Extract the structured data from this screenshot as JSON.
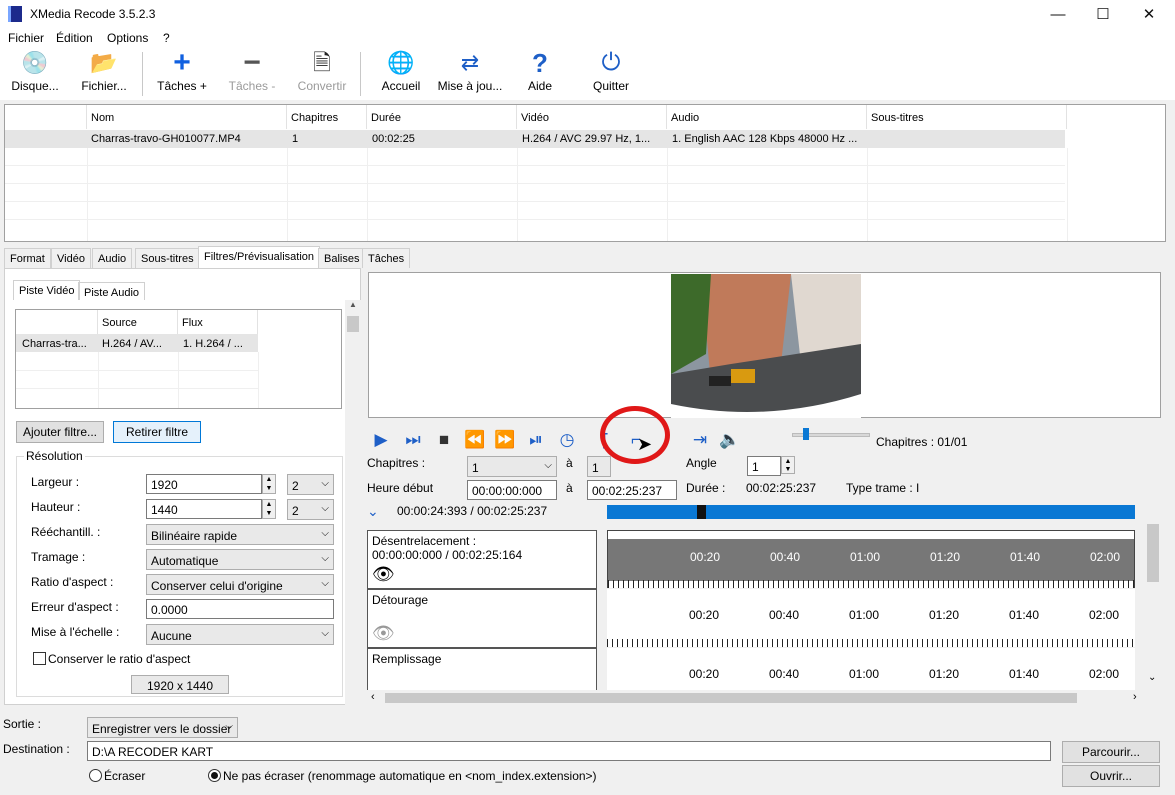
{
  "window": {
    "title": "XMedia Recode 3.5.2.3"
  },
  "menu": [
    "Fichier",
    "Édition",
    "Options",
    "?"
  ],
  "toolbar": {
    "disque": "Disque...",
    "fichier": "Fichier...",
    "taches_plus": "Tâches +",
    "taches_minus": "Tâches -",
    "convertir": "Convertir",
    "accueil": "Accueil",
    "mise": "Mise à jou...",
    "aide": "Aide",
    "quitter": "Quitter"
  },
  "filelist": {
    "headers": [
      "Nom",
      "Chapitres",
      "Durée",
      "Vidéo",
      "Audio",
      "Sous-titres"
    ],
    "row": [
      "Charras-travo-GH010077.MP4",
      "1",
      "00:02:25",
      "H.264 / AVC  29.97 Hz, 1...",
      "1. English AAC  128 Kbps 48000 Hz ...",
      ""
    ]
  },
  "tabs": [
    "Format",
    "Vidéo",
    "Audio",
    "Sous-titres",
    "Filtres/Prévisualisation",
    "Balises",
    "Tâches"
  ],
  "subtabs": [
    "Piste Vidéo",
    "Piste Audio"
  ],
  "stream": {
    "headers": [
      "",
      "Source",
      "Flux"
    ],
    "row": [
      "Charras-tra...",
      "H.264 / AV...",
      "1. H.264 / ..."
    ]
  },
  "buttons": {
    "add_filter": "Ajouter filtre...",
    "remove_filter": "Retirer filtre",
    "browse": "Parcourir...",
    "open": "Ouvrir..."
  },
  "resolution": {
    "group": "Résolution",
    "width_label": "Largeur :",
    "width": "1920",
    "width_div": "2",
    "height_label": "Hauteur :",
    "height": "1440",
    "height_div": "2",
    "resample_label": "Rééchantill. :",
    "resample": "Bilinéaire rapide",
    "dither_label": "Tramage :",
    "dither": "Automatique",
    "aspect_label": "Ratio d'aspect :",
    "aspect": "Conserver celui d'origine",
    "aspect_err_label": "Erreur d'aspect :",
    "aspect_err": "0.0000",
    "scale_label": "Mise à l'échelle :",
    "scale": "Aucune",
    "keep_ratio": "Conserver le ratio d'aspect",
    "size": "1920 x 1440"
  },
  "player": {
    "chapters_info": "Chapitres : 01/01",
    "chapters_label": "Chapitres :",
    "chapter_from": "1",
    "a": "à",
    "chapter_to": "1",
    "angle_label": "Angle",
    "angle": "1",
    "start_label": "Heure début",
    "start": "00:00:00:000",
    "end": "00:02:25:237",
    "duration_label": "Durée :",
    "duration": "00:02:25:237",
    "frame_label": "Type trame :",
    "frame": "I",
    "position": "00:00:24:393 / 00:02:25:237",
    "seek_fraction": 0.17
  },
  "tracks": [
    {
      "name": "Désentrelacement :",
      "time": "00:00:00:000 / 00:02:25:164"
    },
    {
      "name": "Détourage",
      "time": ""
    },
    {
      "name": "Remplissage",
      "time": ""
    }
  ],
  "tick_labels": [
    "00:20",
    "00:40",
    "01:00",
    "01:20",
    "01:40",
    "02:00"
  ],
  "output": {
    "sortie_label": "Sortie :",
    "sortie": "Enregistrer vers le dossier",
    "dest_label": "Destination :",
    "dest": "D:\\A RECODER KART",
    "overwrite": "Écraser",
    "no_overwrite": "Ne pas écraser (renommage automatique en <nom_index.extension>)"
  }
}
